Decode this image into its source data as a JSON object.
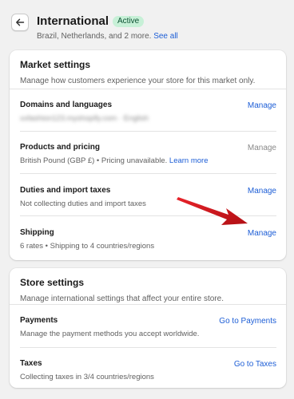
{
  "header": {
    "title": "International",
    "status_badge": "Active",
    "subtitle": "Brazil, Netherlands, and 2 more.",
    "see_all_link": "See all",
    "back_icon": "arrow-left-icon"
  },
  "market_settings": {
    "title": "Market settings",
    "description": "Manage how customers experience your store for this market only.",
    "rows": [
      {
        "title": "Domains and languages",
        "desc": "xxfashion123.myshopify.com · English",
        "action": "Manage"
      },
      {
        "title": "Products and pricing",
        "desc": "British Pound (GBP £) • Pricing unavailable.",
        "desc_link": "Learn more",
        "action": "Manage"
      },
      {
        "title": "Duties and import taxes",
        "desc": "Not collecting duties and import taxes",
        "action": "Manage"
      },
      {
        "title": "Shipping",
        "desc": "6 rates • Shipping to 4 countries/regions",
        "action": "Manage"
      }
    ]
  },
  "store_settings": {
    "title": "Store settings",
    "description": "Manage international settings that affect your entire store.",
    "rows": [
      {
        "title": "Payments",
        "desc": "Manage the payment methods you accept worldwide.",
        "action": "Go to Payments"
      },
      {
        "title": "Taxes",
        "desc": "Collecting taxes in 3/4 countries/regions",
        "action": "Go to Taxes"
      }
    ]
  },
  "colors": {
    "accent_link": "#1d5ed6",
    "badge_bg": "#c7f0d7",
    "annotation_arrow": "#d0161c"
  }
}
